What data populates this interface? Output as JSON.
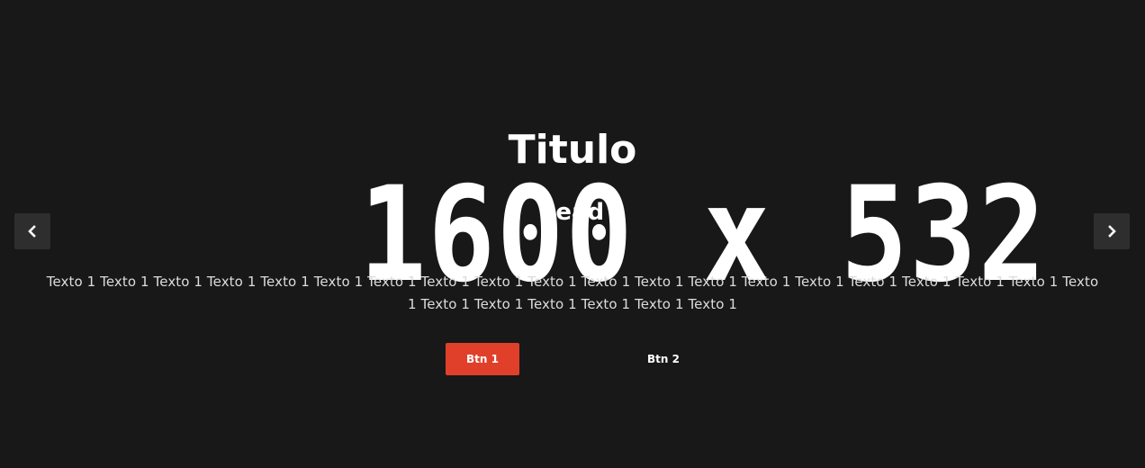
{
  "slide": {
    "placeholder_dimensions": "1600 x 532",
    "title": "Titulo",
    "lead": "Lead",
    "body": "Texto 1 Texto 1 Texto 1 Texto 1 Texto 1 Texto 1 Texto 1 Texto 1 Texto 1 Texto 1 Texto 1 Texto 1 Texto 1 Texto 1 Texto 1 Texto 1 Texto 1 Texto 1 Texto 1 Texto 1 Texto 1 Texto 1 Texto 1 Texto 1 Texto 1 Texto 1",
    "buttons": {
      "primary_label": "Btn 1",
      "secondary_label": "Btn 2"
    }
  },
  "navigation": {
    "prev_icon": "chevron-left-icon",
    "next_icon": "chevron-right-icon"
  },
  "colors": {
    "background": "#181818",
    "primary_button": "#e0402a",
    "arrow_background": "#2e2e2e",
    "text": "#ffffff"
  }
}
